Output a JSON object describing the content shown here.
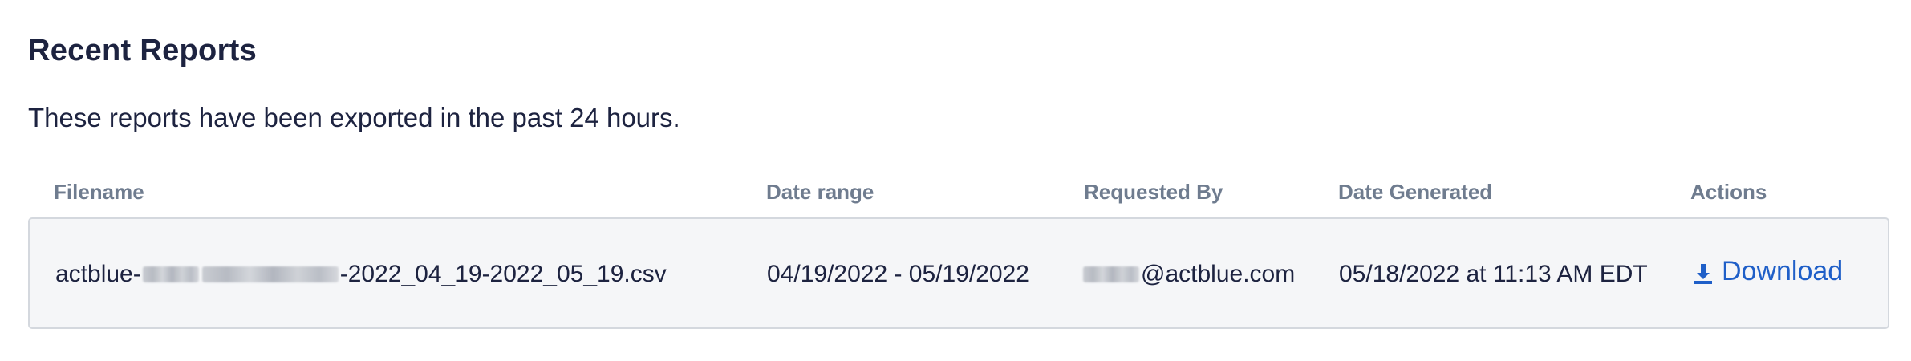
{
  "page": {
    "title": "Recent Reports",
    "subtitle": "These reports have been exported in the past 24 hours."
  },
  "table": {
    "headers": {
      "filename": "Filename",
      "date_range": "Date range",
      "requested_by": "Requested By",
      "date_generated": "Date Generated",
      "actions": "Actions"
    },
    "rows": [
      {
        "filename_prefix": "actblue-",
        "filename_suffix": "-2022_04_19-2022_05_19.csv",
        "date_range": "04/19/2022 - 05/19/2022",
        "requested_by_domain": "@actblue.com",
        "date_generated": "05/18/2022 at 11:13 AM EDT",
        "action_label": "Download"
      }
    ]
  },
  "colors": {
    "heading_text": "#1d2340",
    "header_text": "#6f7c8f",
    "row_background": "#f5f6f8",
    "row_border": "#d4d8de",
    "link": "#1f5fc8"
  },
  "icons": {
    "download": "download-icon"
  }
}
